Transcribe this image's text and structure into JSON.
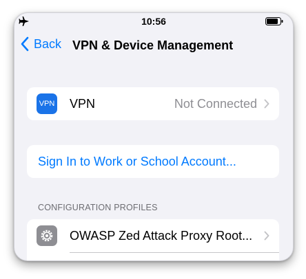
{
  "status_bar": {
    "time": "10:56",
    "airplane_icon": "airplane-icon",
    "battery_icon": "battery-icon"
  },
  "nav": {
    "back_label": "Back",
    "title": "VPN & Device Management"
  },
  "vpn": {
    "badge": "VPN",
    "label": "VPN",
    "status": "Not Connected",
    "badge_color": "#1a73e8"
  },
  "account": {
    "signin_label": "Sign In to Work or School Account..."
  },
  "profiles": {
    "header": "CONFIGURATION PROFILES",
    "items": [
      {
        "label": "OWASP Zed Attack Proxy Root...",
        "icon": "gear-icon"
      }
    ]
  },
  "colors": {
    "accent": "#007aff",
    "background": "#f2f2f7",
    "secondary_text": "#8e8e93"
  }
}
